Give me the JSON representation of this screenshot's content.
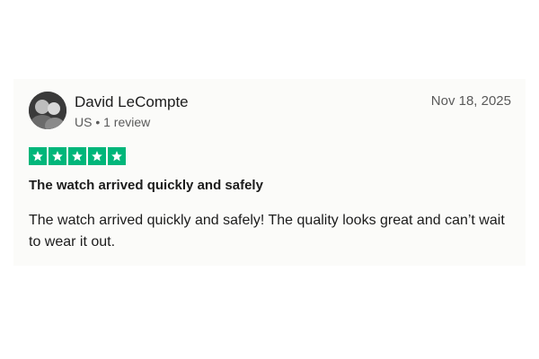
{
  "review": {
    "reviewer_name": "David LeCompte",
    "reviewer_meta": "US • 1 review",
    "date": "Nov 18, 2025",
    "rating": 5,
    "rating_max": 5,
    "title": "The watch arrived quickly and safely",
    "body": "The watch arrived quickly and safely! The quality looks great and can’t wait to wear it out."
  },
  "colors": {
    "star_fill": "#00b67a",
    "star_glyph": "#ffffff",
    "card_background": "#fbfbf9"
  }
}
